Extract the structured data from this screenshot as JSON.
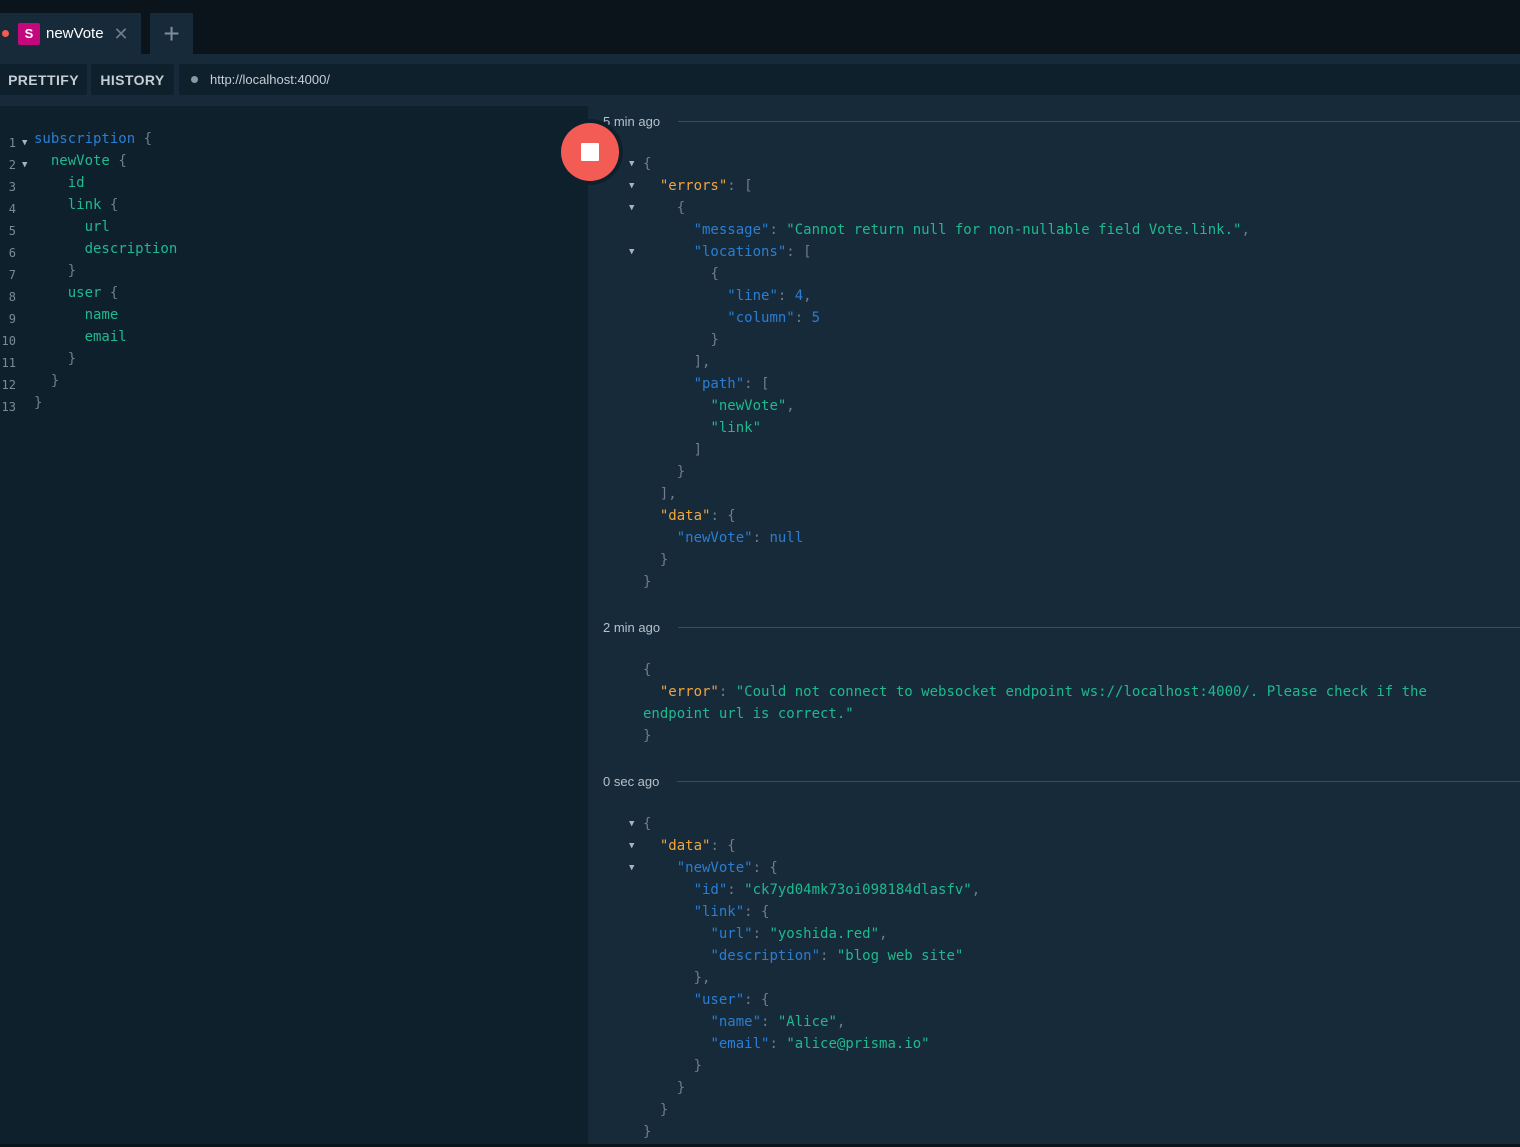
{
  "tab": {
    "badge": "S",
    "title": "newVote",
    "close": "✕",
    "new": "+"
  },
  "toolbar": {
    "prettify": "PRETTIFY",
    "history": "HISTORY",
    "url": "http://localhost:4000/"
  },
  "editor": {
    "line_numbers": [
      "1",
      "2",
      "3",
      "4",
      "5",
      "6",
      "7",
      "8",
      "9",
      "10",
      "11",
      "12",
      "13"
    ],
    "kw_subscription": "subscription",
    "f_newVote": "newVote",
    "f_id": "id",
    "f_link": "link",
    "f_url": "url",
    "f_description": "description",
    "f_user": "user",
    "f_name": "name",
    "f_email": "email"
  },
  "results": {
    "r1": {
      "time": "5 min ago",
      "k_errors": "\"errors\"",
      "k_message": "\"message\"",
      "v_message": "\"Cannot return null for non-nullable field Vote.link.\"",
      "k_locations": "\"locations\"",
      "k_line": "\"line\"",
      "v_line": "4",
      "k_column": "\"column\"",
      "v_column": "5",
      "k_path": "\"path\"",
      "v_path_0": "\"newVote\"",
      "v_path_1": "\"link\"",
      "k_data": "\"data\"",
      "k_newVote": "\"newVote\"",
      "v_newVote": "null"
    },
    "r2": {
      "time": "2 min ago",
      "k_error": "\"error\"",
      "v_error_1": "\"Could not connect to websocket endpoint ws://localhost:4000/. Please check if the",
      "v_error_2": "endpoint url is correct.\""
    },
    "r3": {
      "time": "0 sec ago",
      "k_data": "\"data\"",
      "k_newVote": "\"newVote\"",
      "k_id": "\"id\"",
      "v_id": "\"ck7yd04mk73oi098184dlasfv\"",
      "k_link": "\"link\"",
      "k_url": "\"url\"",
      "v_url": "\"yoshida.red\"",
      "k_description": "\"description\"",
      "v_description": "\"blog web site\"",
      "k_user": "\"user\"",
      "k_name": "\"name\"",
      "v_name": "\"Alice\"",
      "k_email": "\"email\"",
      "v_email": "\"alice@prisma.io\""
    }
  },
  "colors": {
    "run_button": "#f25c54",
    "tab_badge": "#c4077d"
  }
}
